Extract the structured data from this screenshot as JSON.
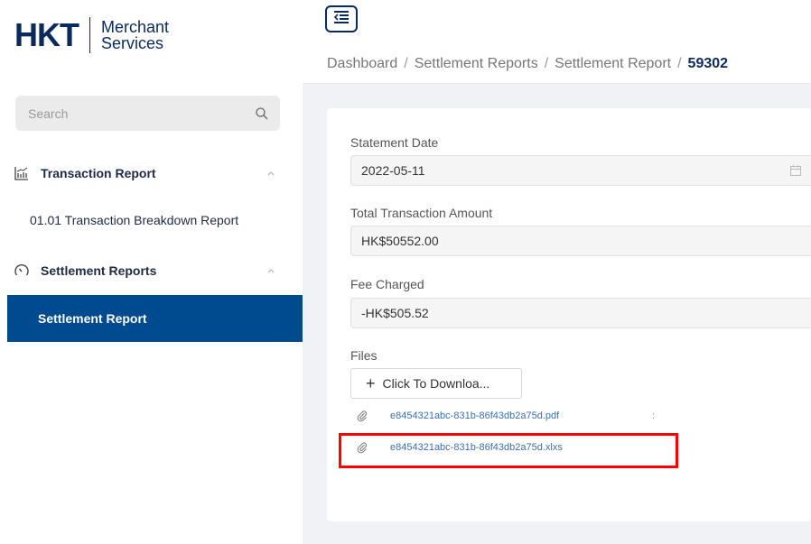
{
  "brand": {
    "mark": "HKT",
    "line1": "Merchant",
    "line2": "Services"
  },
  "search": {
    "placeholder": "Search"
  },
  "sidebar": {
    "groups": [
      {
        "label": "Transaction Report",
        "items": [
          {
            "label": "01.01 Transaction Breakdown Report"
          }
        ]
      },
      {
        "label": "Settlement Reports",
        "items": [
          {
            "label": "Settlement Report",
            "active": true
          }
        ]
      }
    ]
  },
  "breadcrumb": {
    "items": [
      "Dashboard",
      "Settlement Reports",
      "Settlement Report"
    ],
    "current": "59302",
    "separator": "/"
  },
  "form": {
    "statement_date_label": "Statement Date",
    "statement_date_value": "2022-05-11",
    "total_label": "Total Transaction Amount",
    "total_value": "HK$50552.00",
    "fee_label": "Fee Charged",
    "fee_value": "-HK$505.52",
    "files_label": "Files",
    "download_label": "Click To Downloa...",
    "files": [
      {
        "name": "e8454321abc-831b-86f43db2a75d.pdf"
      },
      {
        "name": "e8454321abc-831b-86f43db2a75d.xlxs"
      }
    ],
    "dot": ":"
  },
  "colors": {
    "primary": "#004a8f",
    "brand": "#0a2a5c",
    "link": "#3a6fb5",
    "highlight": "#ff0000"
  }
}
